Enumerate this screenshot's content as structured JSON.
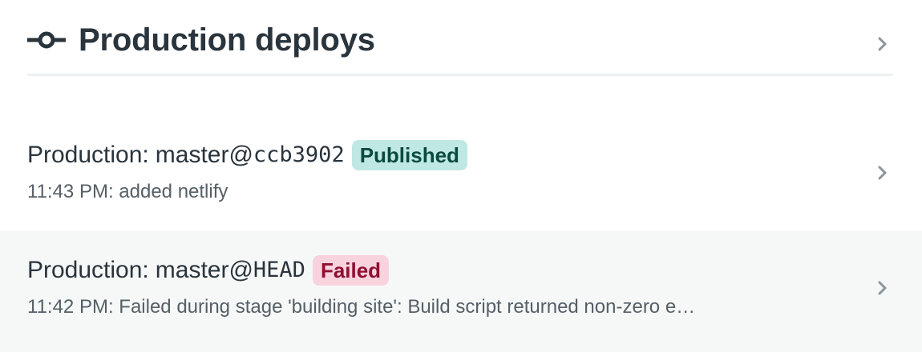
{
  "header": {
    "title": "Production deploys",
    "icon": "git-commit-icon"
  },
  "deploys": [
    {
      "context": "Production:",
      "branch": "master@",
      "commit": "ccb3902",
      "status": "Published",
      "time": "11:43 PM",
      "message": "added netlify",
      "summary": "11:43 PM: added netlify"
    },
    {
      "context": "Production:",
      "branch": "master@",
      "commit": "HEAD",
      "status": "Failed",
      "time": "11:42 PM",
      "message": "Failed during stage 'building site': Build script returned non-zero e…",
      "summary": "11:42 PM: Failed during stage 'building site': Build script returned non-zero e…"
    }
  ],
  "colors": {
    "published_bg": "#bfe8e4",
    "published_text": "#0a4a3e",
    "failed_bg": "#f8d3de",
    "failed_text": "#8f0f31",
    "row_alt_bg": "#f6f8f8"
  },
  "icons": {
    "chevron": "chevron-right-icon"
  }
}
